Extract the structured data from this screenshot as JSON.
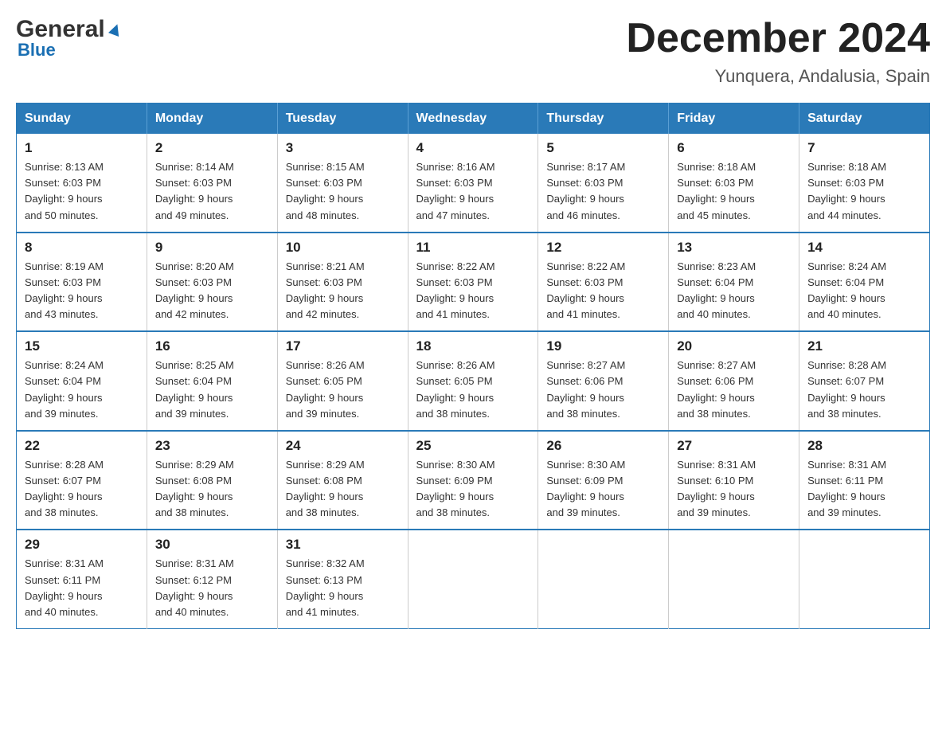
{
  "header": {
    "logo_general": "General",
    "logo_blue": "Blue",
    "month_title": "December 2024",
    "location": "Yunquera, Andalusia, Spain"
  },
  "columns": [
    "Sunday",
    "Monday",
    "Tuesday",
    "Wednesday",
    "Thursday",
    "Friday",
    "Saturday"
  ],
  "weeks": [
    [
      {
        "day": "1",
        "sunrise": "8:13 AM",
        "sunset": "6:03 PM",
        "daylight": "9 hours and 50 minutes."
      },
      {
        "day": "2",
        "sunrise": "8:14 AM",
        "sunset": "6:03 PM",
        "daylight": "9 hours and 49 minutes."
      },
      {
        "day": "3",
        "sunrise": "8:15 AM",
        "sunset": "6:03 PM",
        "daylight": "9 hours and 48 minutes."
      },
      {
        "day": "4",
        "sunrise": "8:16 AM",
        "sunset": "6:03 PM",
        "daylight": "9 hours and 47 minutes."
      },
      {
        "day": "5",
        "sunrise": "8:17 AM",
        "sunset": "6:03 PM",
        "daylight": "9 hours and 46 minutes."
      },
      {
        "day": "6",
        "sunrise": "8:18 AM",
        "sunset": "6:03 PM",
        "daylight": "9 hours and 45 minutes."
      },
      {
        "day": "7",
        "sunrise": "8:18 AM",
        "sunset": "6:03 PM",
        "daylight": "9 hours and 44 minutes."
      }
    ],
    [
      {
        "day": "8",
        "sunrise": "8:19 AM",
        "sunset": "6:03 PM",
        "daylight": "9 hours and 43 minutes."
      },
      {
        "day": "9",
        "sunrise": "8:20 AM",
        "sunset": "6:03 PM",
        "daylight": "9 hours and 42 minutes."
      },
      {
        "day": "10",
        "sunrise": "8:21 AM",
        "sunset": "6:03 PM",
        "daylight": "9 hours and 42 minutes."
      },
      {
        "day": "11",
        "sunrise": "8:22 AM",
        "sunset": "6:03 PM",
        "daylight": "9 hours and 41 minutes."
      },
      {
        "day": "12",
        "sunrise": "8:22 AM",
        "sunset": "6:03 PM",
        "daylight": "9 hours and 41 minutes."
      },
      {
        "day": "13",
        "sunrise": "8:23 AM",
        "sunset": "6:04 PM",
        "daylight": "9 hours and 40 minutes."
      },
      {
        "day": "14",
        "sunrise": "8:24 AM",
        "sunset": "6:04 PM",
        "daylight": "9 hours and 40 minutes."
      }
    ],
    [
      {
        "day": "15",
        "sunrise": "8:24 AM",
        "sunset": "6:04 PM",
        "daylight": "9 hours and 39 minutes."
      },
      {
        "day": "16",
        "sunrise": "8:25 AM",
        "sunset": "6:04 PM",
        "daylight": "9 hours and 39 minutes."
      },
      {
        "day": "17",
        "sunrise": "8:26 AM",
        "sunset": "6:05 PM",
        "daylight": "9 hours and 39 minutes."
      },
      {
        "day": "18",
        "sunrise": "8:26 AM",
        "sunset": "6:05 PM",
        "daylight": "9 hours and 38 minutes."
      },
      {
        "day": "19",
        "sunrise": "8:27 AM",
        "sunset": "6:06 PM",
        "daylight": "9 hours and 38 minutes."
      },
      {
        "day": "20",
        "sunrise": "8:27 AM",
        "sunset": "6:06 PM",
        "daylight": "9 hours and 38 minutes."
      },
      {
        "day": "21",
        "sunrise": "8:28 AM",
        "sunset": "6:07 PM",
        "daylight": "9 hours and 38 minutes."
      }
    ],
    [
      {
        "day": "22",
        "sunrise": "8:28 AM",
        "sunset": "6:07 PM",
        "daylight": "9 hours and 38 minutes."
      },
      {
        "day": "23",
        "sunrise": "8:29 AM",
        "sunset": "6:08 PM",
        "daylight": "9 hours and 38 minutes."
      },
      {
        "day": "24",
        "sunrise": "8:29 AM",
        "sunset": "6:08 PM",
        "daylight": "9 hours and 38 minutes."
      },
      {
        "day": "25",
        "sunrise": "8:30 AM",
        "sunset": "6:09 PM",
        "daylight": "9 hours and 38 minutes."
      },
      {
        "day": "26",
        "sunrise": "8:30 AM",
        "sunset": "6:09 PM",
        "daylight": "9 hours and 39 minutes."
      },
      {
        "day": "27",
        "sunrise": "8:31 AM",
        "sunset": "6:10 PM",
        "daylight": "9 hours and 39 minutes."
      },
      {
        "day": "28",
        "sunrise": "8:31 AM",
        "sunset": "6:11 PM",
        "daylight": "9 hours and 39 minutes."
      }
    ],
    [
      {
        "day": "29",
        "sunrise": "8:31 AM",
        "sunset": "6:11 PM",
        "daylight": "9 hours and 40 minutes."
      },
      {
        "day": "30",
        "sunrise": "8:31 AM",
        "sunset": "6:12 PM",
        "daylight": "9 hours and 40 minutes."
      },
      {
        "day": "31",
        "sunrise": "8:32 AM",
        "sunset": "6:13 PM",
        "daylight": "9 hours and 41 minutes."
      },
      null,
      null,
      null,
      null
    ]
  ],
  "labels": {
    "sunrise": "Sunrise:",
    "sunset": "Sunset:",
    "daylight": "Daylight:"
  }
}
